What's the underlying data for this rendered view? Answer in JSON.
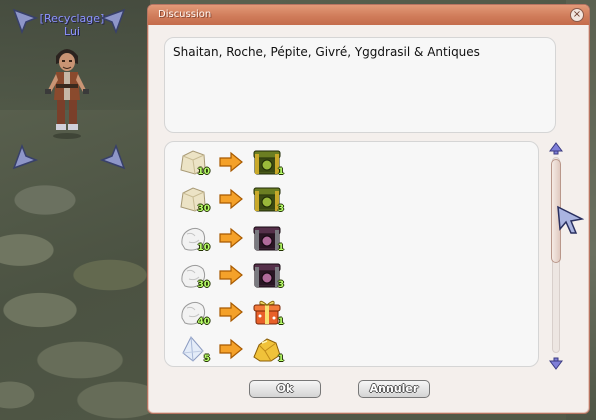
{
  "npc": {
    "name_line1": "[Recyclage]",
    "name_line2": "Lui"
  },
  "background_npc_label": "[R",
  "dialog": {
    "title": "Discussion",
    "close_symbol": "×",
    "message": "Shaitan, Roche, Pépite, Givré, Yggdrasil & Antiques"
  },
  "choices": [
    {
      "source_icon": "rock-icon",
      "source_qty": "10",
      "target_icon": "green-box-icon",
      "target_qty": "1"
    },
    {
      "source_icon": "rock-icon",
      "source_qty": "30",
      "target_icon": "green-box-icon",
      "target_qty": "3"
    },
    {
      "source_icon": "white-stone-icon",
      "source_qty": "10",
      "target_icon": "purple-box-icon",
      "target_qty": "1"
    },
    {
      "source_icon": "white-stone-icon",
      "source_qty": "30",
      "target_icon": "purple-box-icon",
      "target_qty": "3"
    },
    {
      "source_icon": "white-stone-icon",
      "source_qty": "40",
      "target_icon": "gift-box-icon",
      "target_qty": "1"
    },
    {
      "source_icon": "crystal-icon",
      "source_qty": "5",
      "target_icon": "gold-nugget-icon",
      "target_qty": "1"
    }
  ],
  "buttons": {
    "ok": "Ok",
    "cancel": "Annuler"
  },
  "colors": {
    "title_bar": "#d07c5a",
    "dialog_border": "#b77462",
    "panel_bg": "#f7f7f7",
    "qty_text": "#b8ff6a",
    "npc_name": "#8d94ff"
  }
}
